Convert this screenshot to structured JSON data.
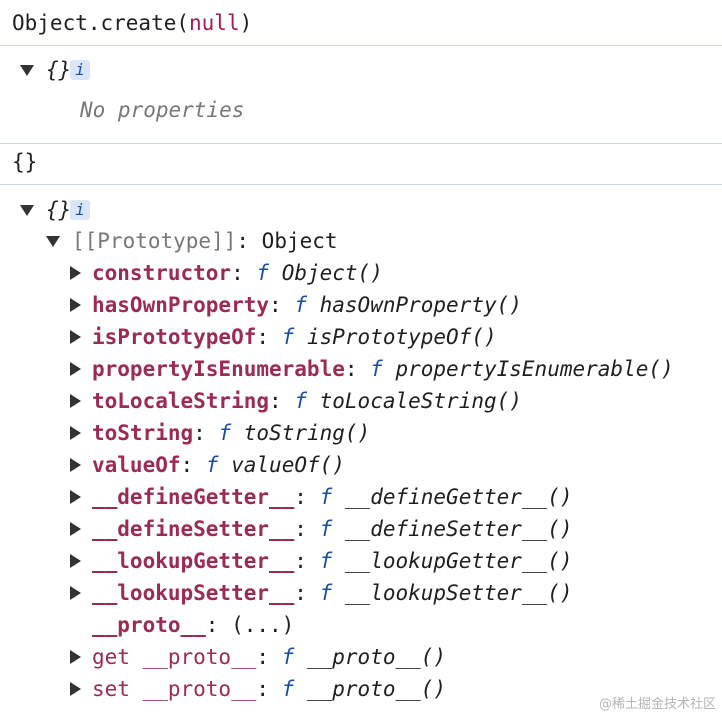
{
  "console": {
    "expr1": {
      "prefix": "Object.create(",
      "arg": "null",
      "suffix": ")"
    },
    "result1": {
      "label": "{}",
      "info_badge": "i",
      "empty_text": "No properties"
    },
    "expr2": {
      "text": "{}"
    },
    "result2": {
      "label": "{}",
      "info_badge": "i",
      "proto_label": "[[Prototype]]",
      "proto_colon": ": ",
      "proto_value": "Object",
      "members": [
        {
          "key": "constructor",
          "colon": ": ",
          "f": "f",
          "value": "Object()"
        },
        {
          "key": "hasOwnProperty",
          "colon": ": ",
          "f": "f",
          "value": "hasOwnProperty()"
        },
        {
          "key": "isPrototypeOf",
          "colon": ": ",
          "f": "f",
          "value": "isPrototypeOf()"
        },
        {
          "key": "propertyIsEnumerable",
          "colon": ": ",
          "f": "f",
          "value": "propertyIsEnumerable()"
        },
        {
          "key": "toLocaleString",
          "colon": ": ",
          "f": "f",
          "value": "toLocaleString()"
        },
        {
          "key": "toString",
          "colon": ": ",
          "f": "f",
          "value": "toString()"
        },
        {
          "key": "valueOf",
          "colon": ": ",
          "f": "f",
          "value": "valueOf()"
        },
        {
          "key": "__defineGetter__",
          "colon": ": ",
          "f": "f",
          "value": "__defineGetter__()"
        },
        {
          "key": "__defineSetter__",
          "colon": ": ",
          "f": "f",
          "value": "__defineSetter__()"
        },
        {
          "key": "__lookupGetter__",
          "colon": ": ",
          "f": "f",
          "value": "__lookupGetter__()"
        },
        {
          "key": "__lookupSetter__",
          "colon": ": ",
          "f": "f",
          "value": "__lookupSetter__()"
        }
      ],
      "proto_accessor": {
        "key": "__proto__",
        "colon": ": ",
        "value": "(...)"
      },
      "getter": {
        "prefix": "get ",
        "key": "__proto__",
        "colon": ": ",
        "f": "f",
        "value": "__proto__()"
      },
      "setter": {
        "prefix": "set ",
        "key": "__proto__",
        "colon": ": ",
        "f": "f",
        "value": "__proto__()"
      }
    }
  },
  "watermark": "@稀土掘金技术社区"
}
